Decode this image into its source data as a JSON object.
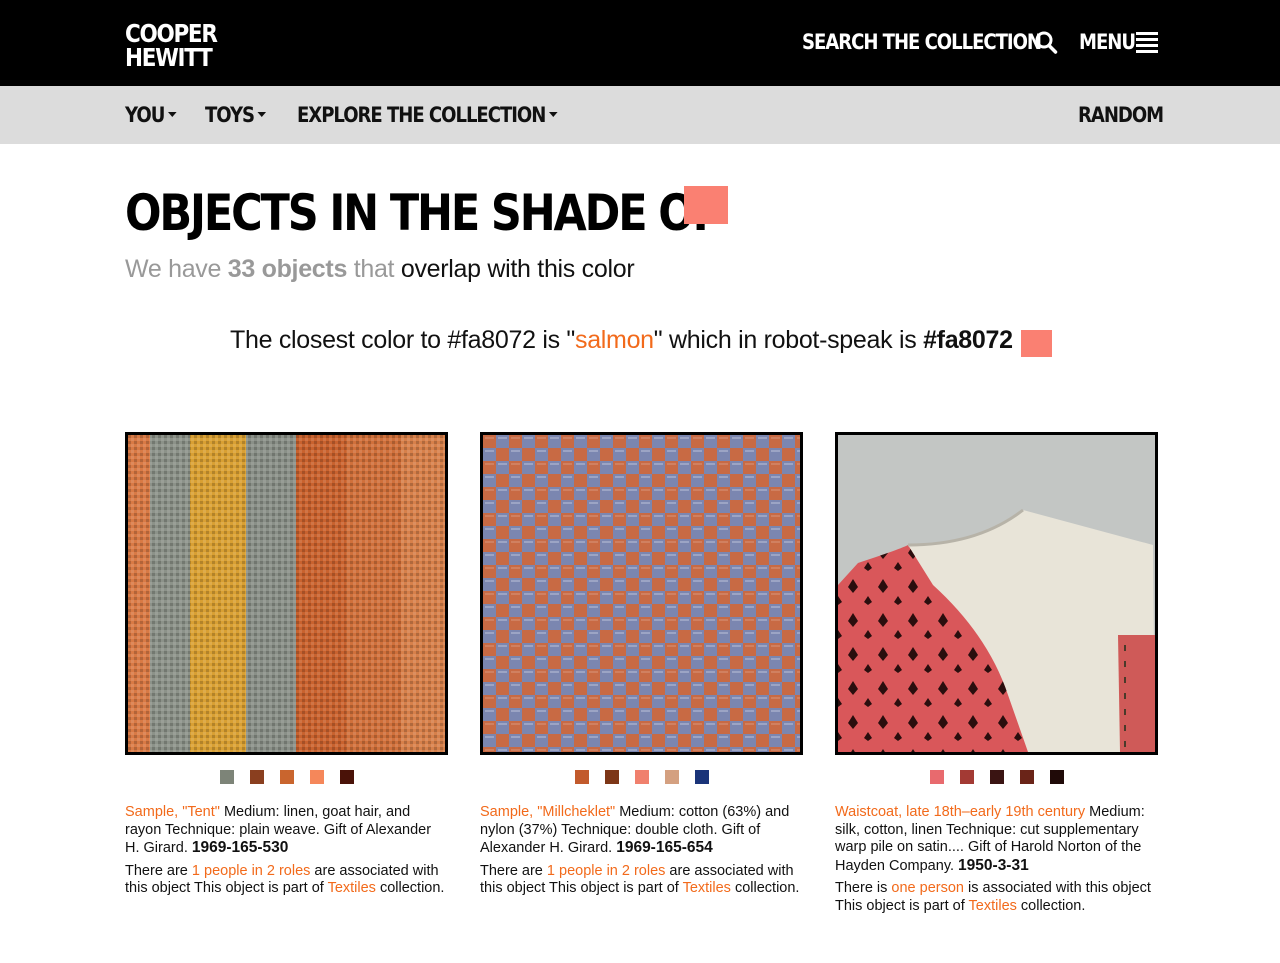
{
  "colors": {
    "accent": "#f26a1b",
    "shade": "#fa8072",
    "topbar": "#000000",
    "subnav": "#dcdcdc"
  },
  "header": {
    "logo_line1": "COOPER",
    "logo_line2": "HEWITT",
    "search_label": "SEARCH THE COLLECTION",
    "search_icon": "search-icon",
    "menu_label": "MENU",
    "menu_icon": "hamburger-icon"
  },
  "subnav": {
    "items": [
      {
        "label": "YOU"
      },
      {
        "label": "TOYS"
      },
      {
        "label": "EXPLORE THE COLLECTION"
      }
    ],
    "random_label": "RANDOM"
  },
  "main": {
    "title": "OBJECTS IN THE SHADE OF",
    "subtitle": {
      "prefix": "We have",
      "count": "33 objects",
      "middle": "that",
      "suffix": "overlap with this color"
    },
    "closest": {
      "prefix": "The closest color to #fa8072 is \"",
      "name": "salmon",
      "middle": "\" which in robot-speak is",
      "hex": "#fa8072"
    }
  },
  "objects": [
    {
      "title": "Sample, \"Tent\"",
      "description": " Medium: linen, goat hair, and rayon Technique: plain weave. Gift of Alexander H. Girard. ",
      "accession": "1969-165-530",
      "people_prefix": "There are ",
      "people_link": "1 people in 2 roles",
      "people_suffix": " are associated with this object This object is part of ",
      "collection": "Textiles",
      "collection_suffix": " collection.",
      "swatches": [
        "#7d8478",
        "#8a3f1f",
        "#c9652e",
        "#f5875a",
        "#4a1208"
      ]
    },
    {
      "title": "Sample, \"Millcheklet\"",
      "description": " Medium: cotton (63%) and nylon (37%) Technique: double cloth. Gift of Alexander H. Girard. ",
      "accession": "1969-165-654",
      "people_prefix": "There are ",
      "people_link": "1 people in 2 roles",
      "people_suffix": " are associated with this object This object is part of ",
      "collection": "Textiles",
      "collection_suffix": " collection.",
      "swatches": [
        "#c25a2c",
        "#7d3617",
        "#f0806d",
        "#d4a080",
        "#1a3479"
      ]
    },
    {
      "title": "Waistcoat, late 18th–early 19th century",
      "description": " Medium: silk, cotton, linen Technique: cut supplementary warp pile on satin.... Gift of Harold Norton of the Hayden Company. ",
      "accession": "1950-3-31",
      "people_prefix": "There is ",
      "people_link": "one person",
      "people_suffix": " is associated with this object This object is part of ",
      "collection": "Textiles",
      "collection_suffix": " collection.",
      "swatches": [
        "#e86a6e",
        "#a33a34",
        "#3a1412",
        "#6a2418",
        "#200a08"
      ]
    }
  ]
}
